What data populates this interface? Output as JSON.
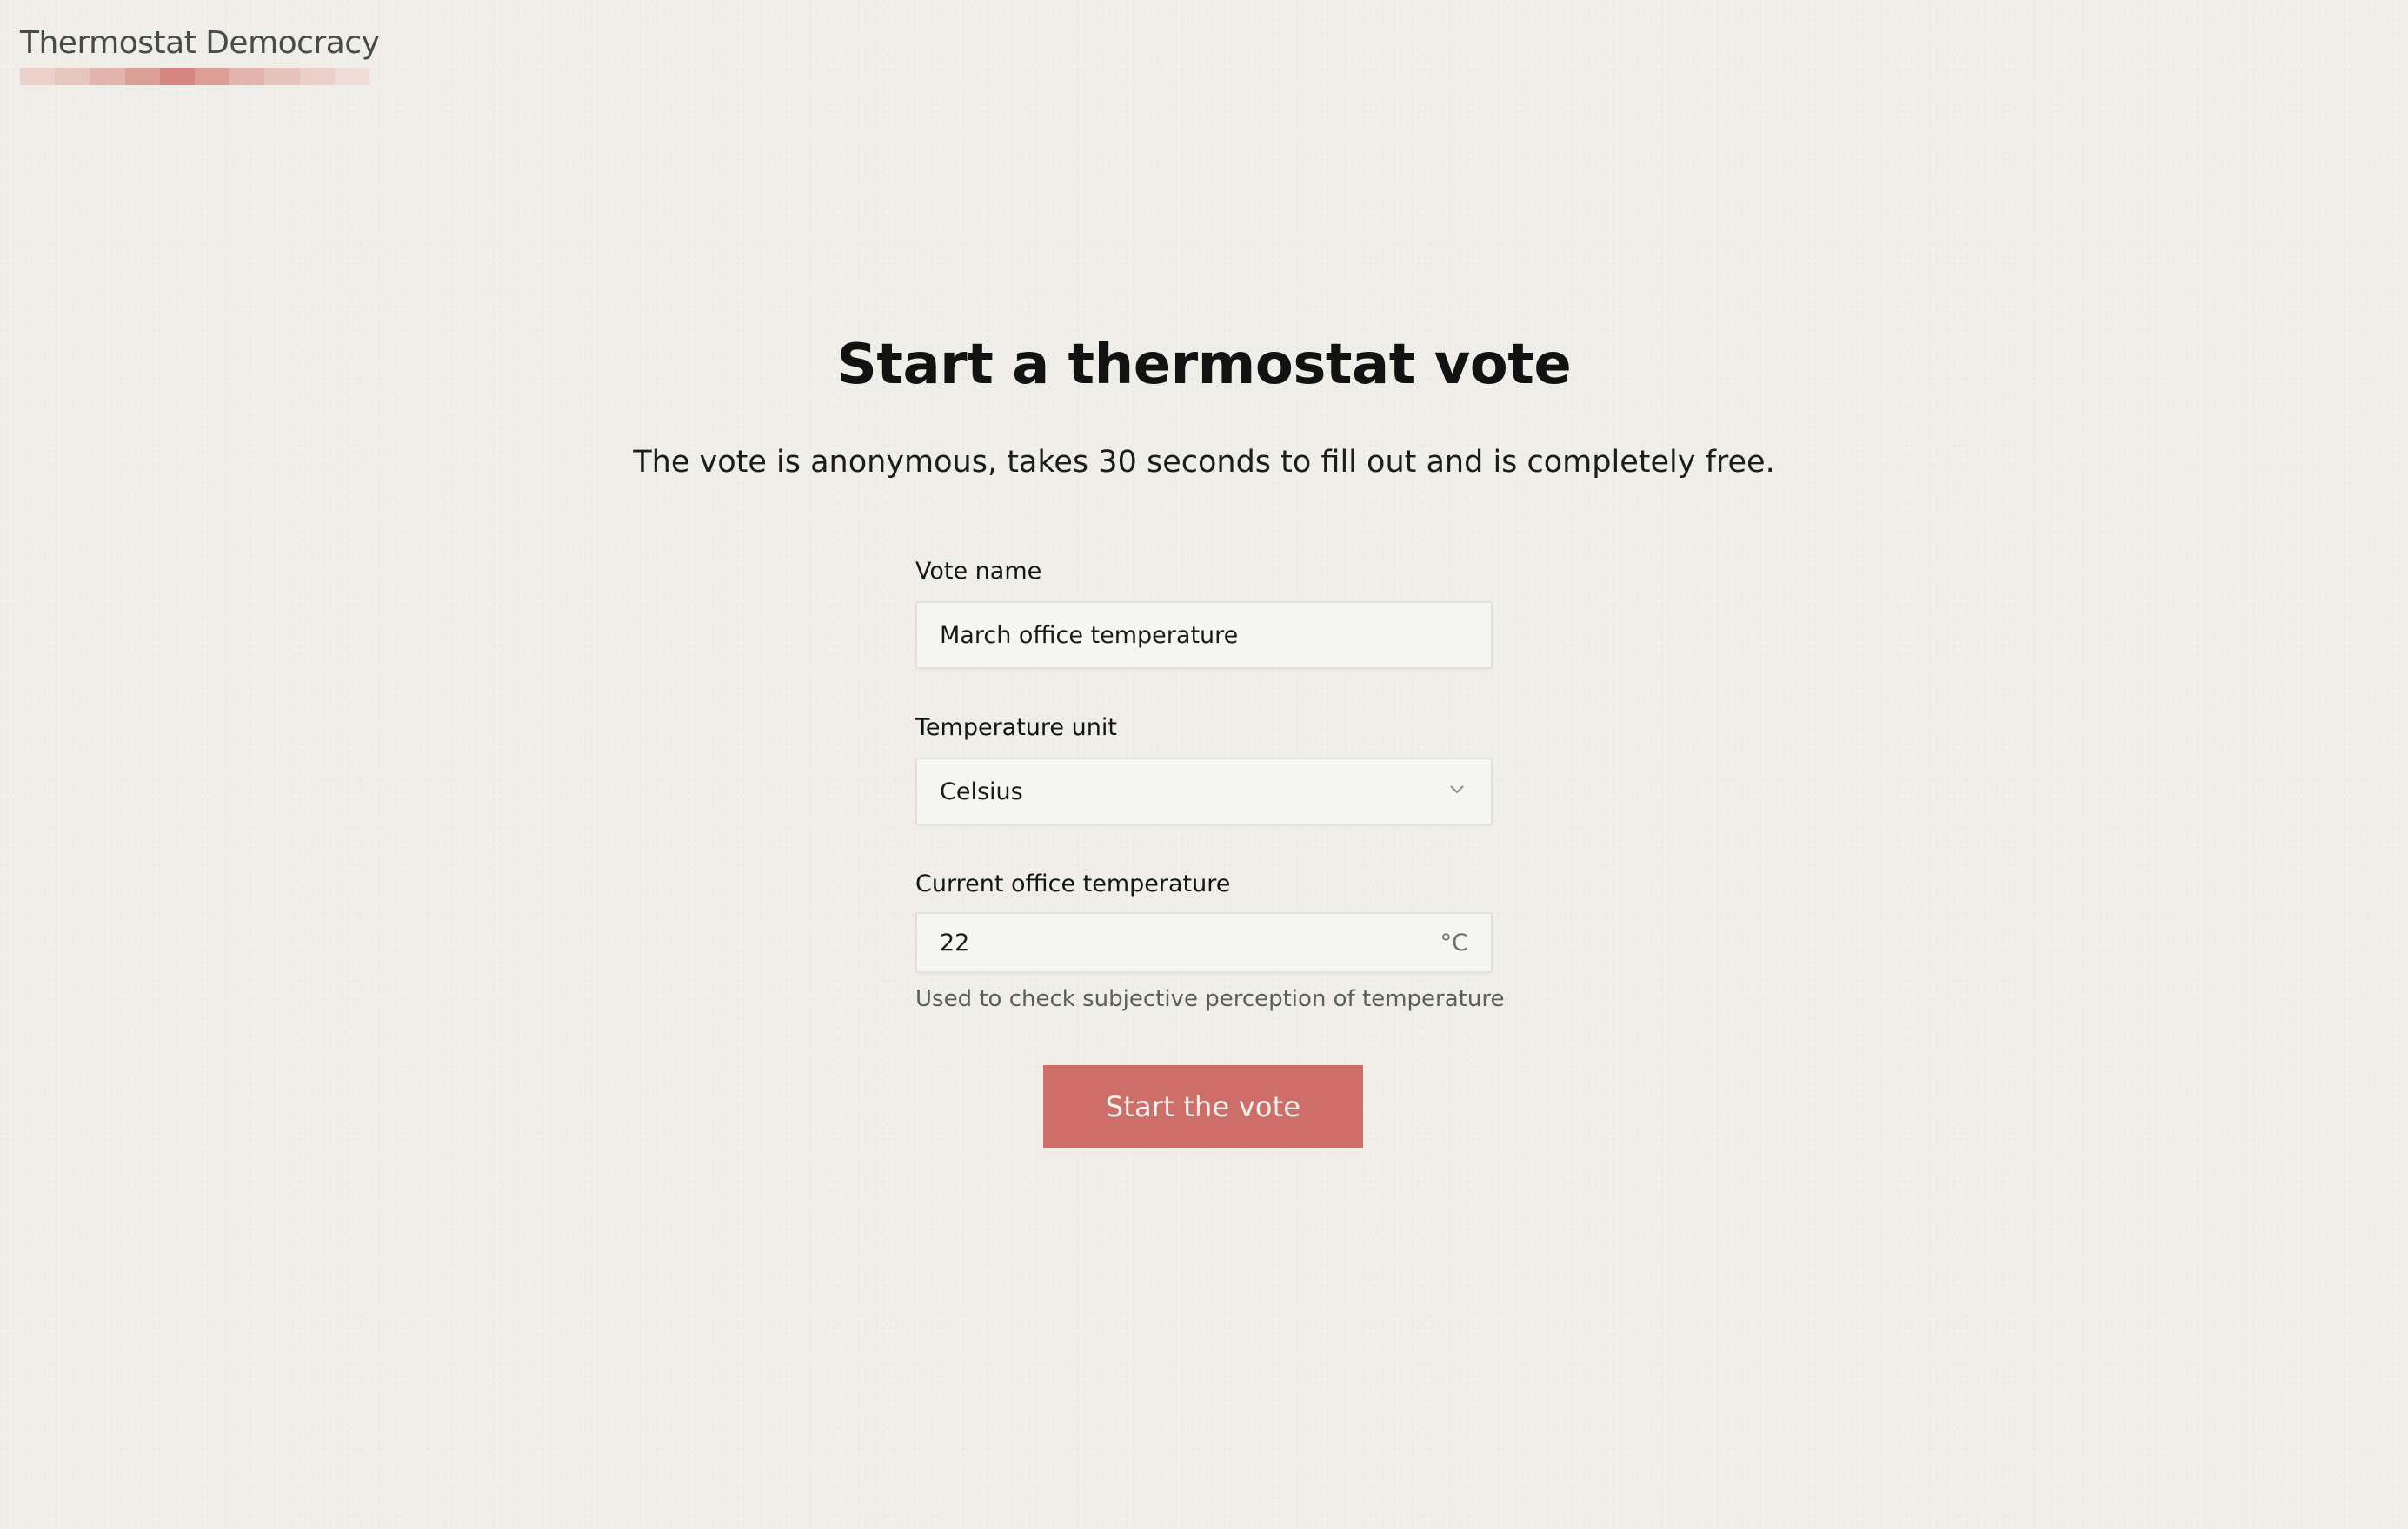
{
  "header": {
    "brand_name": "Thermostat Democracy",
    "underline_colors": [
      "#ecd1cb",
      "#e8c6c0",
      "#e3b4ad",
      "#dc9f97",
      "#d6877f",
      "#dd9e96",
      "#e3b4ad",
      "#e7c3bd",
      "#ebd0ca",
      "#efdcd7"
    ]
  },
  "main": {
    "title": "Start a thermostat vote",
    "subtitle": "The vote is anonymous, takes 30 seconds to fill out and is completely free."
  },
  "form": {
    "vote_name": {
      "label": "Vote name",
      "value": "March office temperature"
    },
    "temperature_unit": {
      "label": "Temperature unit",
      "value": "Celsius"
    },
    "current_temperature": {
      "label": "Current office temperature",
      "value": "22",
      "unit_suffix": "°C",
      "hint": "Used to check subjective perception of temperature"
    },
    "submit_label": "Start the vote"
  },
  "colors": {
    "background": "#efeee9",
    "accent": "#cd6f68",
    "field_background": "#f5f5f1"
  }
}
